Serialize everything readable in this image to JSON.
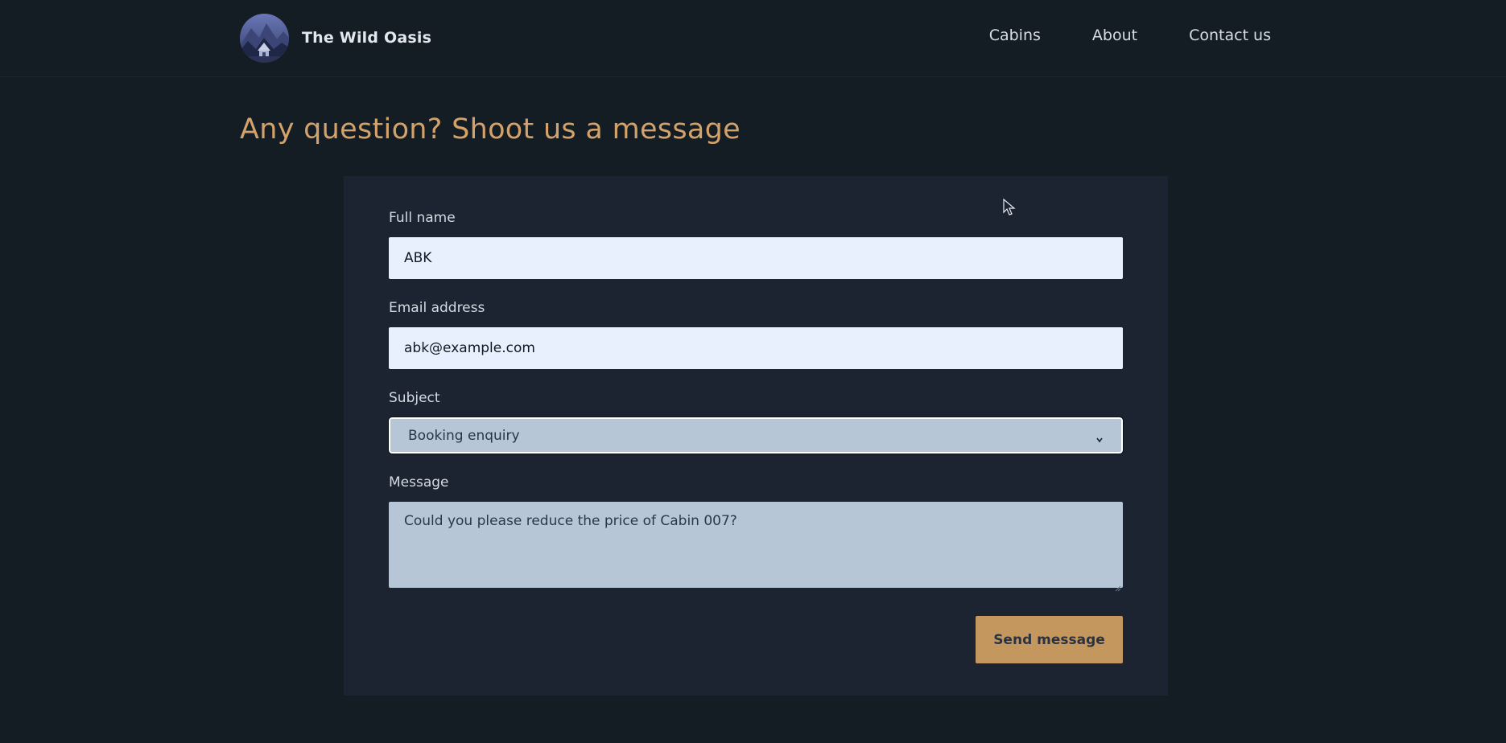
{
  "header": {
    "brand": "The Wild Oasis",
    "logo_icon": "cabin-mountain-logo-icon",
    "nav": [
      {
        "label": "Cabins"
      },
      {
        "label": "About"
      },
      {
        "label": "Contact us"
      }
    ]
  },
  "main": {
    "title": "Any question? Shoot us a message"
  },
  "form": {
    "full_name": {
      "label": "Full name",
      "value": "ABK"
    },
    "email": {
      "label": "Email address",
      "value": "abk@example.com"
    },
    "subject": {
      "label": "Subject",
      "value": "Booking enquiry",
      "icon": "chevron-down-icon"
    },
    "message": {
      "label": "Message",
      "value": "Could you please reduce the price of Cabin 007?"
    },
    "submit_label": "Send message"
  },
  "colors": {
    "background": "#141c24",
    "card": "#1b2430",
    "accent": "#c4975f",
    "title": "#d2a26a",
    "input_bg": "#e8f0fd",
    "select_bg": "#b6c6d7"
  }
}
